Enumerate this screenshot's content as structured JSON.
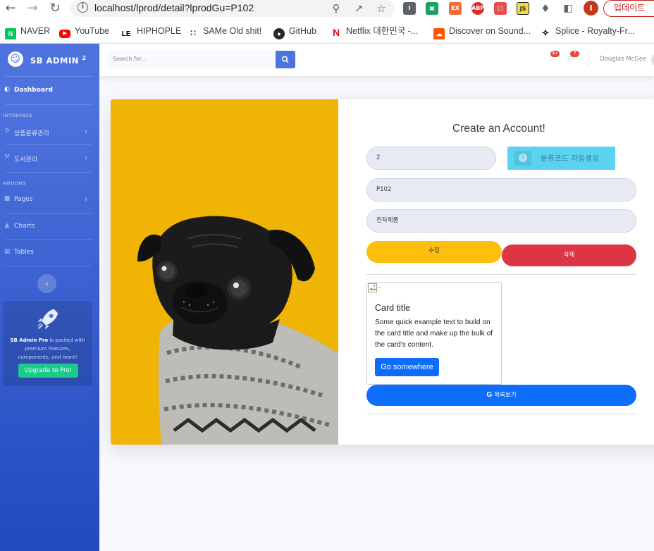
{
  "browser": {
    "url": "localhost/lprod/detail?lprodGu=P102",
    "update_label": "업데이트",
    "profile_initial": "I",
    "extensions": [
      "I",
      "ABP",
      "JS"
    ]
  },
  "bookmarks": [
    {
      "label": "NAVER",
      "icon": "naver-icon"
    },
    {
      "label": "YouTube",
      "icon": "youtube-icon"
    },
    {
      "label": "HIPHOPLE",
      "icon": "hiphople-icon"
    },
    {
      "label": "SAMe Old shit!",
      "icon": "same-icon"
    },
    {
      "label": "GitHub",
      "icon": "github-icon"
    },
    {
      "label": "Netflix 대한민국 -...",
      "icon": "netflix-icon"
    },
    {
      "label": "Discover on Sound...",
      "icon": "soundcloud-icon"
    },
    {
      "label": "Splice - Royalty-Fr...",
      "icon": "splice-icon"
    }
  ],
  "sidebar": {
    "brand": "SB ADMIN",
    "brand_sup": "2",
    "dashboard": "Dashboard",
    "heading_interface": "INTERFACE",
    "item_category": "상품분류관리",
    "item_books": "도서관리",
    "heading_addons": "ADDONS",
    "item_pages": "Pages",
    "item_charts": "Charts",
    "item_tables": "Tables",
    "promo_bold": "SB Admin Pro",
    "promo_text": " is packed with premium features, components, and more!",
    "promo_button": "Upgrade to Pro!"
  },
  "topbar": {
    "search_placeholder": "Search for...",
    "alerts_badge": "3+",
    "messages_badge": "7",
    "user_name": "Douglas McGee"
  },
  "form": {
    "title": "Create an Account!",
    "category_value": "2",
    "auto_button": "분류코드 자동생성",
    "code_value": "P102",
    "name_value": "전자제품",
    "edit_button": "수정",
    "delete_button": "삭제",
    "list_button": "목록보기"
  },
  "card": {
    "img_alt": "...",
    "title": "Card title",
    "text": "Some quick example text to build on the card title and make up the bulk of the card's content.",
    "button": "Go somewhere"
  },
  "colors": {
    "sidebar_top": "#4e73df",
    "sidebar_bottom": "#224abe",
    "dog_background": "#efb404",
    "edit_button": "#fdbf0b",
    "delete_button": "#dc3545",
    "primary_button": "#0d6efd",
    "auto_button": "#5bd3f0"
  }
}
